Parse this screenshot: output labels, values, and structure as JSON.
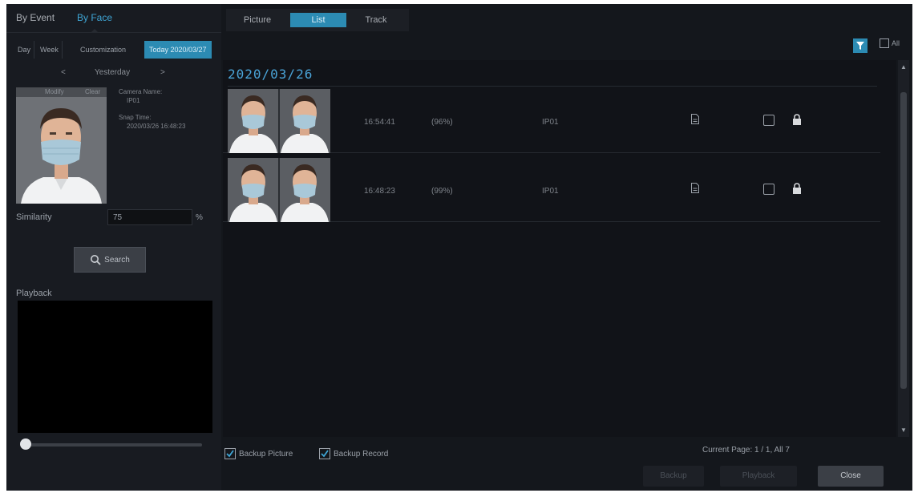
{
  "left": {
    "tabs": [
      "By Event",
      "By Face"
    ],
    "active_tab": "By Face",
    "ranges": [
      "Day",
      "Week",
      "Customization",
      "Today 2020/03/27"
    ],
    "day_nav": {
      "prev": "<",
      "label": "Yesterday",
      "next": ">"
    },
    "face_card": {
      "modify": "Modify",
      "clear": "Clear"
    },
    "meta": {
      "camera_label": "Camera Name:",
      "camera_value": "IP01",
      "snap_label": "Snap Time:",
      "snap_value": "2020/03/26 16:48:23"
    },
    "similarity": {
      "label": "Similarity",
      "value": "75",
      "unit": "%"
    },
    "search_label": "Search",
    "playback_label": "Playback",
    "playback_progress": 0.0
  },
  "view_tabs": [
    "Picture",
    "List",
    "Track"
  ],
  "active_view": "List",
  "all_label": "All",
  "list": {
    "date": "2020/03/26",
    "rows": [
      {
        "time": "16:54:41",
        "score": "(96%)",
        "channel": "IP01"
      },
      {
        "time": "16:48:23",
        "score": "(99%)",
        "channel": "IP01"
      }
    ]
  },
  "footer": {
    "backup_picture": "Backup Picture",
    "backup_record": "Backup Record",
    "page_info": "Current Page: 1 / 1, All 7",
    "buttons": {
      "backup": "Backup",
      "playback": "Playback",
      "close": "Close"
    }
  },
  "colors": {
    "accent": "#2c8bb3",
    "date": "#4aa4d8",
    "panel": "#181b21"
  }
}
